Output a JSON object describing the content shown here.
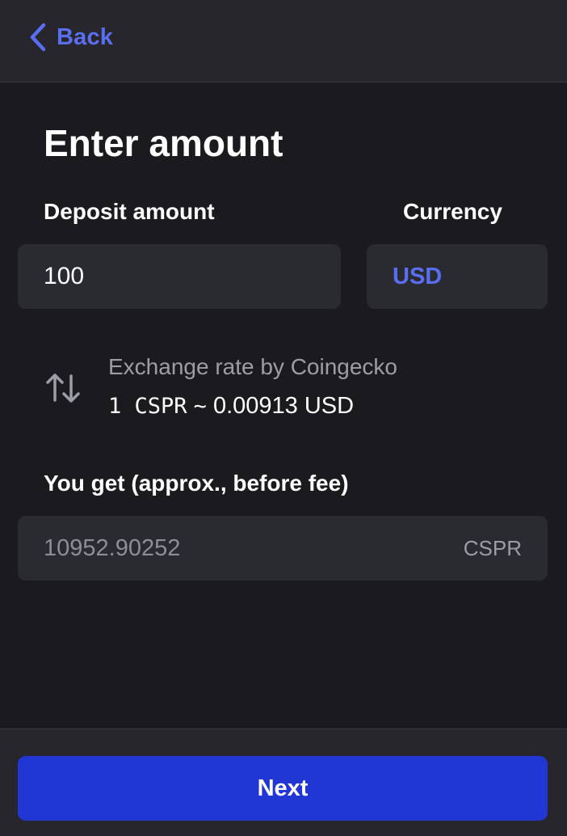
{
  "header": {
    "back_label": "Back",
    "back_icon": "chevron-left-icon"
  },
  "main": {
    "title": "Enter amount",
    "deposit": {
      "label": "Deposit amount",
      "value": "100"
    },
    "currency": {
      "label": "Currency",
      "selected": "USD"
    },
    "exchange": {
      "icon": "swap-vertical-icon",
      "caption": "Exchange rate by Coingecko",
      "from": "1 CSPR",
      "separator": "~",
      "to": "0.00913 USD"
    },
    "result": {
      "label": "You get (approx., before fee)",
      "value": "10952.90252",
      "unit": "CSPR"
    }
  },
  "footer": {
    "next_label": "Next"
  },
  "colors": {
    "background": "#1b1b1f",
    "panel": "#26262c",
    "input": "#2a2a31",
    "accent": "#5a6ff0",
    "primary_button": "#2137d4",
    "muted_text": "#9d9da6"
  }
}
